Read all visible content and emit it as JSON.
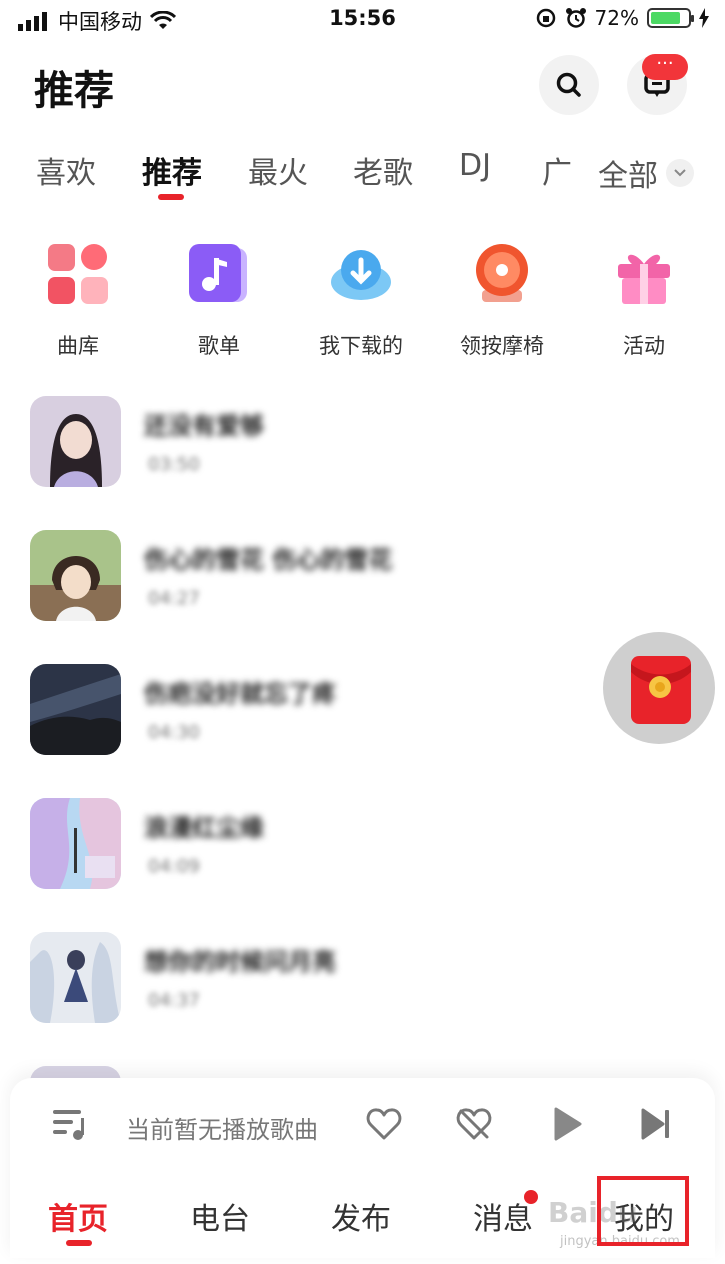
{
  "status_bar": {
    "carrier": "中国移动",
    "time": "15:56",
    "battery": "72%"
  },
  "header": {
    "title": "推荐",
    "message_badge": "···"
  },
  "tabs": [
    {
      "label": "喜欢"
    },
    {
      "label": "推荐"
    },
    {
      "label": "最火"
    },
    {
      "label": "老歌"
    },
    {
      "label": "DJ"
    },
    {
      "label": "广"
    }
  ],
  "tab_all": "全部",
  "quick_entries": [
    {
      "label": "曲库"
    },
    {
      "label": "歌单"
    },
    {
      "label": "我下载的"
    },
    {
      "label": "领按摩椅"
    },
    {
      "label": "活动"
    }
  ],
  "songs": [
    {
      "title": "还没有爱够",
      "duration": "03:50"
    },
    {
      "title": "伤心的雪花 伤心的雪花",
      "duration": "04:27"
    },
    {
      "title": "伤疤没好就忘了疼",
      "duration": "04:30"
    },
    {
      "title": "浪漫红尘缘",
      "duration": "04:09"
    },
    {
      "title": "想你的时候问月亮",
      "duration": "04:37"
    }
  ],
  "player": {
    "now_playing": "当前暂无播放歌曲"
  },
  "bottom_nav": [
    {
      "label": "首页"
    },
    {
      "label": "电台"
    },
    {
      "label": "发布"
    },
    {
      "label": "消息"
    },
    {
      "label": "我的"
    }
  ],
  "watermark": {
    "brand": "Baidu",
    "url": "jingyan.baidu.com"
  },
  "colors": {
    "accent": "#e8232a",
    "battery": "#4cd964"
  }
}
